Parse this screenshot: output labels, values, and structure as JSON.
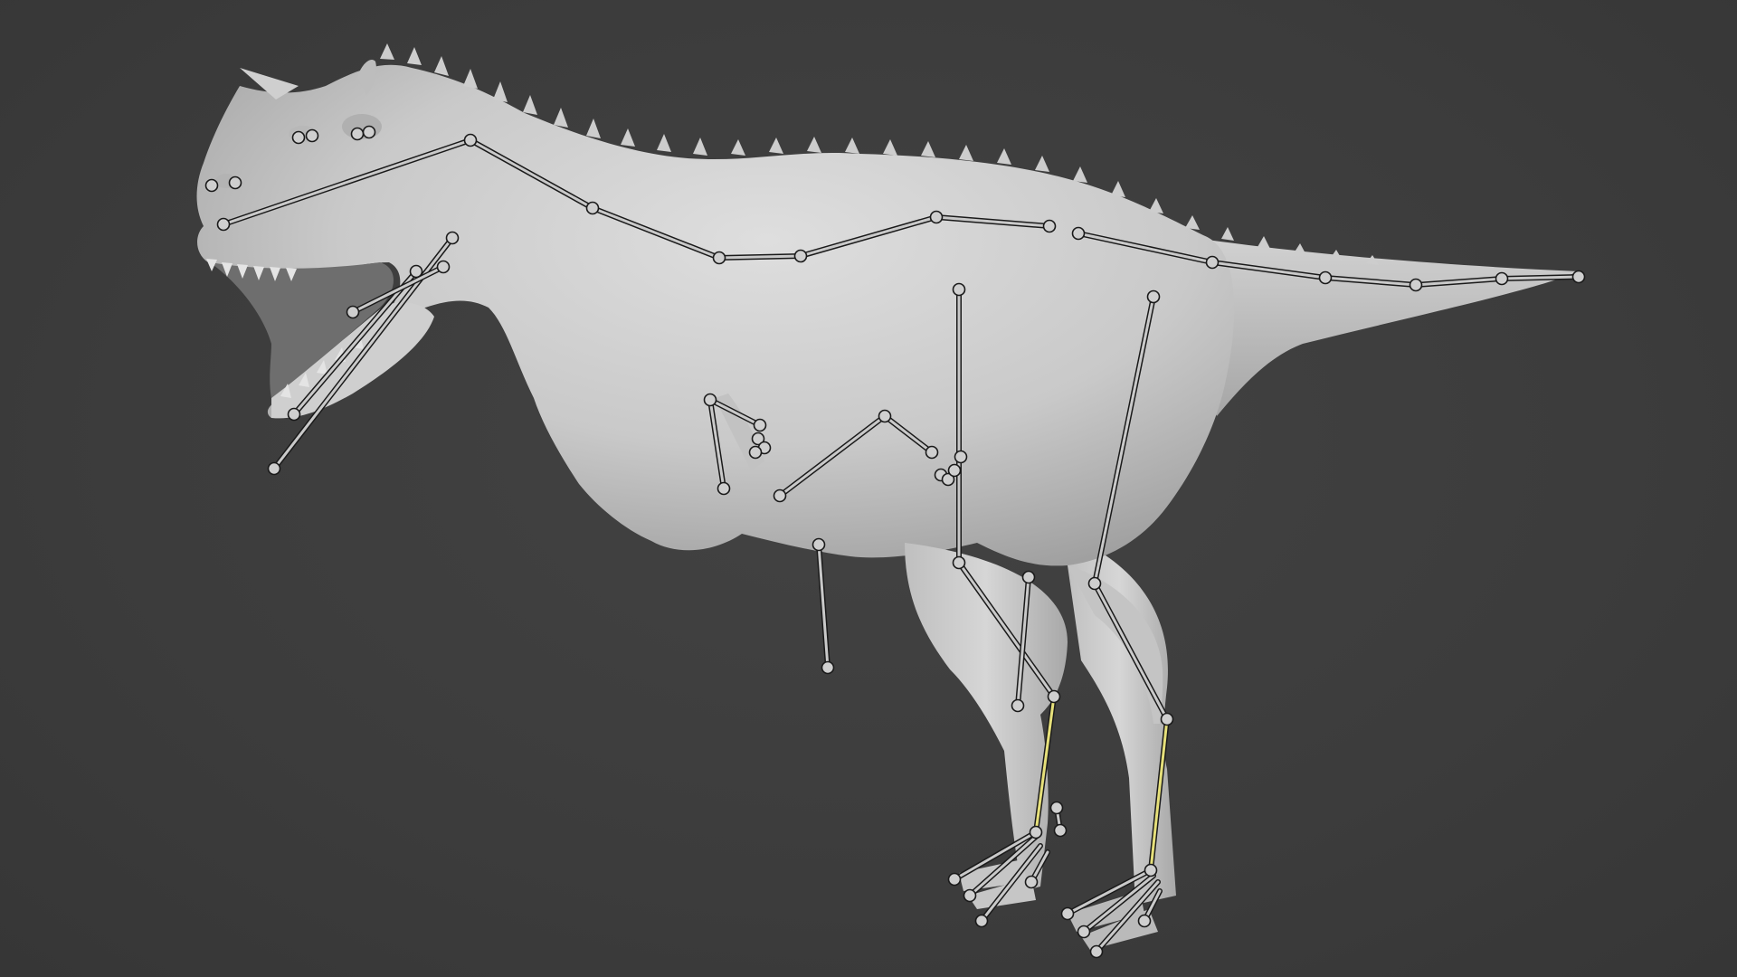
{
  "viewport": {
    "background": "#3d3d3d",
    "mode": "Pose Mode"
  },
  "model": {
    "subject": "carnotaurus-sculpt",
    "skin_color": "#d3d3d3",
    "shadow_color": "#8c8c8c"
  },
  "armature": {
    "bone_color": "#c9c9c9",
    "selected_bone_color": "#e6e07a",
    "joint_color": "#cfcfcf",
    "outline_color": "#1a1a1a",
    "selected_bones": [
      "left-shin-bone",
      "right-shin-bone"
    ]
  }
}
